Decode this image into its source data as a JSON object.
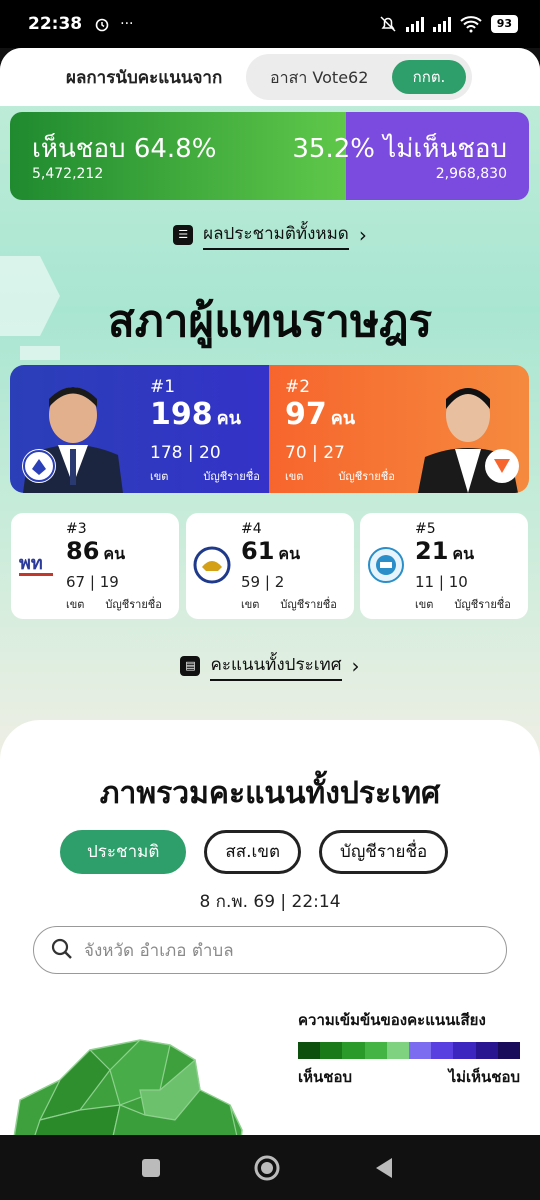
{
  "status_bar": {
    "time": "22:38",
    "alarm_icon": "alarm-icon",
    "more": "···",
    "battery": "93"
  },
  "header": {
    "label": "ผลการนับคะแนนจาก",
    "source_options": [
      "อาสา Vote62",
      "กกต."
    ],
    "selected": "กกต."
  },
  "referendum": {
    "yes_label": "เห็นชอบ 64.8%",
    "yes_votes": "5,472,212",
    "yes_share": 64.8,
    "no_label": "35.2% ไม่เห็นชอบ",
    "no_votes": "2,968,830",
    "no_share": 35.2,
    "link": "ผลประชามติทั้งหมด"
  },
  "house": {
    "title": "สภาผู้แทนราษฎร",
    "seats_unit": "คน",
    "constituency_label": "เขต",
    "list_label": "บัญชีรายชื่อ",
    "parties": [
      {
        "rank": "#1",
        "seats": "198",
        "constituency": "178",
        "list": "20",
        "color": "#2b3fb8"
      },
      {
        "rank": "#2",
        "seats": "97",
        "constituency": "70",
        "list": "27",
        "color": "#f7652d"
      },
      {
        "rank": "#3",
        "seats": "86",
        "constituency": "67",
        "list": "19",
        "logo_text": "พท"
      },
      {
        "rank": "#4",
        "seats": "61",
        "constituency": "59",
        "list": "2",
        "logo_text": "กธ"
      },
      {
        "rank": "#5",
        "seats": "21",
        "constituency": "11",
        "list": "10"
      }
    ],
    "link": "คะแนนทั้งประเทศ"
  },
  "overview": {
    "title": "ภาพรวมคะแนนทั้งประเทศ",
    "tabs": [
      "ประชามติ",
      "สส.เขต",
      "บัญชีรายชื่อ"
    ],
    "active_tab": "ประชามติ",
    "timestamp": "8 ก.พ. 69 | 22:14",
    "search_placeholder": "จังหวัด อำเภอ ตำบล",
    "legend": {
      "title": "ความเข้มข้นของคะแนนเสียง",
      "left": "เห็นชอบ",
      "right": "ไม่เห็นชอบ",
      "colors": [
        "#0d4f0d",
        "#1a7a1a",
        "#2a9a2a",
        "#44b544",
        "#7fd27f",
        "#7b6cf0",
        "#5a3fe0",
        "#3d25c0",
        "#2a1590",
        "#1a0a5a"
      ]
    }
  },
  "colors": {
    "accent": "#2e9e6a",
    "yes": "#3aa63a",
    "no": "#7b4be0"
  }
}
